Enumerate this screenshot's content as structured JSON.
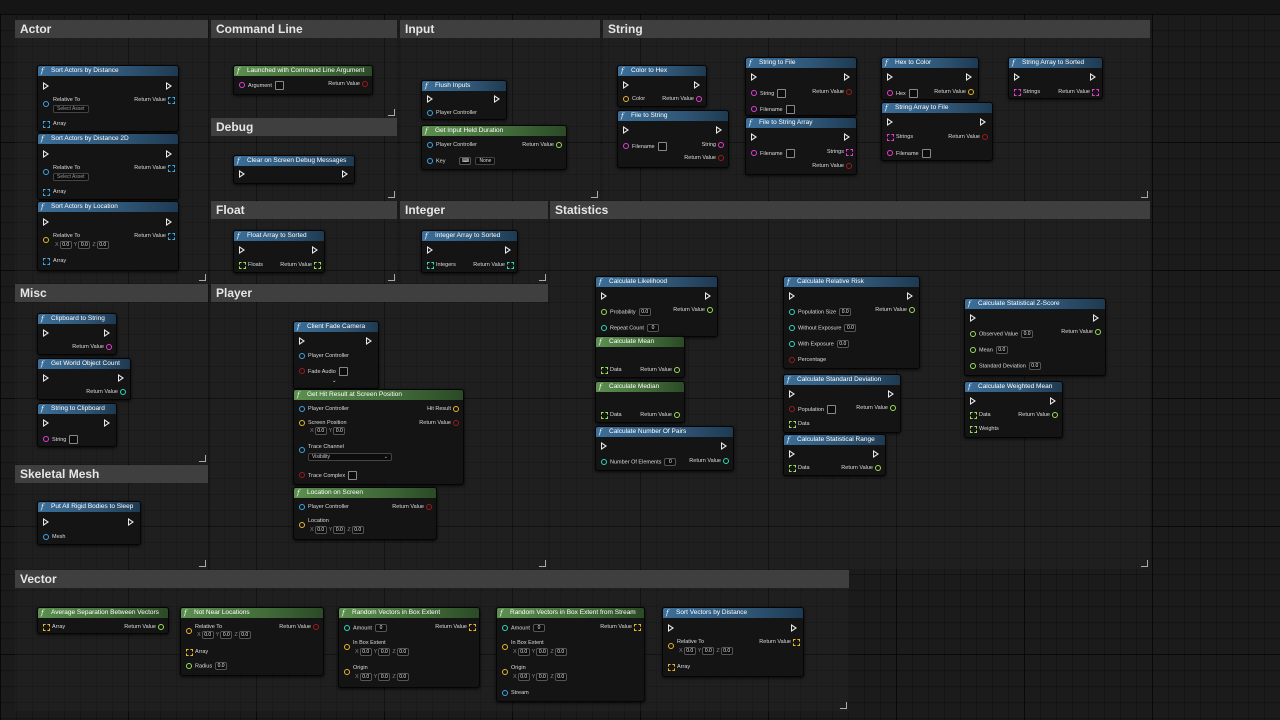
{
  "sections": {
    "actor": "Actor",
    "command_line": "Command Line",
    "input": "Input",
    "string": "String",
    "debug": "Debug",
    "float": "Float",
    "integer": "Integer",
    "statistics": "Statistics",
    "misc": "Misc",
    "player": "Player",
    "skeletal_mesh": "Skeletal Mesh",
    "vector": "Vector"
  },
  "labels": {
    "return_value": "Return Value",
    "relative_to": "Relative To",
    "select_asset": "Select Asset",
    "array": "Array",
    "argument": "Argument",
    "player_controller": "Player Controller",
    "key": "Key",
    "none": "None",
    "color": "Color",
    "filename": "Filename",
    "string": "String",
    "strings": "Strings",
    "hex": "Hex",
    "floats": "Floats",
    "integers": "Integers",
    "probability": "Probability",
    "repeat_count": "Repeat Count",
    "data": "Data",
    "number_of_elements": "Number Of Elements",
    "population_size": "Population Size",
    "without_exposure": "Without Exposure",
    "with_exposure": "With Exposure",
    "percentage": "Percentage",
    "population": "Population",
    "observed_value": "Observed Value",
    "mean": "Mean",
    "standard_deviation": "Standard Deviation",
    "weights": "Weights",
    "fade_audio": "Fade Audio",
    "hit_result": "Hit Result",
    "screen_position": "Screen Position",
    "trace_channel": "Trace Channel",
    "visibility": "Visibility",
    "trace_complex": "Trace Complex",
    "location": "Location",
    "mesh": "Mesh",
    "radius": "Radius",
    "amount": "Amount",
    "in_box_extent": "In Box Extent",
    "origin": "Origin",
    "stream": "Stream",
    "zero": "0.0",
    "zero_int": "0",
    "x": "X",
    "y": "Y",
    "z": "Z"
  },
  "nodes": {
    "sort_actors_by_distance": "Sort Actors by Distance",
    "sort_actors_by_distance_2d": "Sort Actors by Distance 2D",
    "sort_actors_by_location": "Sort Actors by Location",
    "launched_with_command_line_argument": "Launched with Command Line Argument",
    "clear_on_screen_debug_messages": "Clear on Screen Debug Messages",
    "flush_inputs": "Flush Inputs",
    "get_input_held_duration": "Get Input Held Duration",
    "color_to_hex": "Color to Hex",
    "file_to_string": "File to String",
    "string_to_file": "String to File",
    "file_to_string_array": "File to String Array",
    "hex_to_color": "Hex to Color",
    "string_array_to_file": "String Array to File",
    "string_array_to_sorted": "String Array to Sorted",
    "float_array_to_sorted": "Float Array to Sorted",
    "integer_array_to_sorted": "Integer Array to Sorted",
    "calculate_likelihood": "Calculate Likelihood",
    "calculate_mean": "Calculate Mean",
    "calculate_median": "Calculate Median",
    "calculate_number_of_pairs": "Calculate Number Of Pairs",
    "calculate_relative_risk": "Calculate Relative Risk",
    "calculate_standard_deviation": "Calculate Standard Deviation",
    "calculate_statistical_range": "Calculate Statistical Range",
    "calculate_statistical_z_score": "Calculate Statistical Z-Score",
    "calculate_weighted_mean": "Calculate Weighted Mean",
    "clipboard_to_string": "Clipboard to String",
    "get_world_object_count": "Get World Object Count",
    "string_to_clipboard": "String to Clipboard",
    "client_fade_camera": "Client Fade Camera",
    "get_hit_result_at_screen_position": "Get Hit Result at Screen Position",
    "location_on_screen": "Location on Screen",
    "put_all_rigid_bodies_to_sleep": "Put All Rigid Bodies to Sleep",
    "average_separation_between_vectors": "Average Separation Between Vectors",
    "not_near_locations": "Not Near Locations",
    "random_vectors_in_box_extent": "Random Vectors in Box Extent",
    "random_vectors_in_box_extent_from_stream": "Random Vectors in Box Extent from Stream",
    "sort_vectors_by_distance": "Sort Vectors by Distance"
  },
  "colors": {
    "exec": "#e8e8e8",
    "object": "#3da7e8",
    "struct": "#e8b52e",
    "float": "#9be05a",
    "int": "#33d8b5",
    "string": "#e83ed0",
    "bool": "#a11a1a",
    "array": "#3da7e8",
    "header_impure": "#2f5676",
    "header_pure": "#416b39"
  }
}
